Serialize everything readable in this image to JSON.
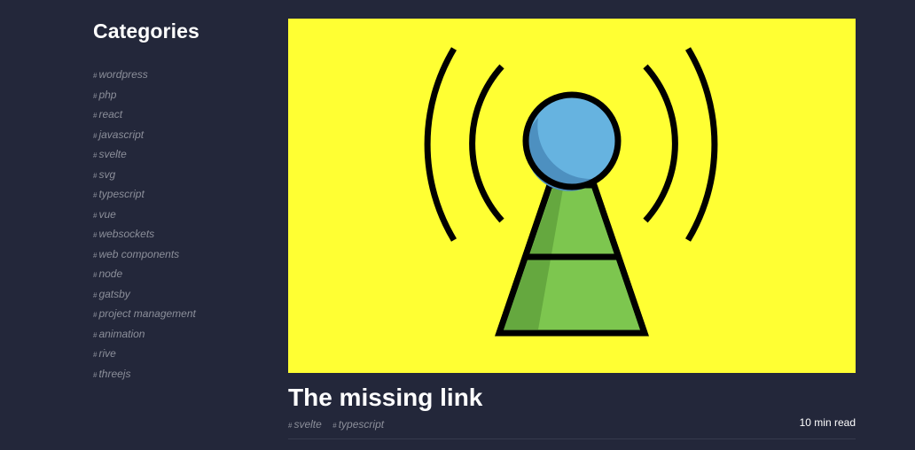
{
  "sidebar": {
    "title": "Categories",
    "hash_symbol": "#",
    "categories": [
      "wordpress",
      "php",
      "react",
      "javascript",
      "svelte",
      "svg",
      "typescript",
      "vue",
      "websockets",
      "web components",
      "node",
      "gatsby",
      "project management",
      "animation",
      "rive",
      "threejs"
    ]
  },
  "post": {
    "title": "The missing link",
    "tags": [
      "svelte",
      "typescript"
    ],
    "read_time": "10 min read",
    "hero_image": {
      "icon": "radio-tower-icon",
      "background": "#ffff33"
    }
  },
  "colors": {
    "page_background": "#23273a",
    "heading": "#ffffff",
    "link_muted": "#8c8f9a",
    "tower_green": "#7dc64f",
    "tower_green_shade": "#65a83f",
    "tower_blue": "#66b3e0",
    "tower_blue_shade": "#4d90c0"
  }
}
